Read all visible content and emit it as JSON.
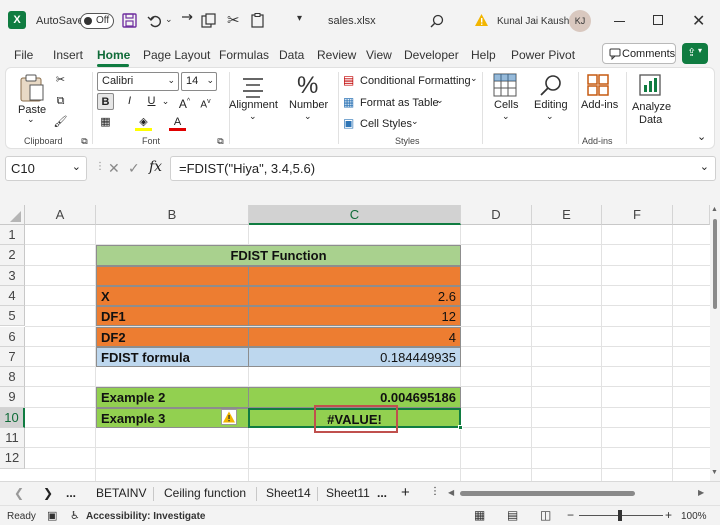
{
  "titlebar": {
    "autosave_label": "AutoSave",
    "autosave_state": "Off",
    "filename": "sales.xlsx",
    "user_name": "Kunal Jai Kaushik",
    "user_initials": "KJ"
  },
  "menu": {
    "items": [
      "File",
      "Insert",
      "Home",
      "Page Layout",
      "Formulas",
      "Data",
      "Review",
      "View",
      "Developer",
      "Help",
      "Power Pivot"
    ],
    "active": "Home",
    "comments_label": "Comments"
  },
  "ribbon": {
    "clipboard": {
      "paste": "Paste",
      "label": "Clipboard"
    },
    "font": {
      "name": "Calibri",
      "size": "14",
      "label": "Font",
      "bold": "B",
      "italic": "I",
      "underline": "U"
    },
    "alignment": {
      "label": "Alignment"
    },
    "number": {
      "label": "Number"
    },
    "styles": {
      "conditional": "Conditional Formatting",
      "table": "Format as Table",
      "cell_styles": "Cell Styles",
      "label": "Styles"
    },
    "cells": {
      "label": "Cells"
    },
    "editing": {
      "label": "Editing"
    },
    "addins": {
      "label": "Add-ins",
      "group_label": "Add-ins"
    },
    "analyze": {
      "label1": "Analyze",
      "label2": "Data"
    }
  },
  "formula_bar": {
    "name_box": "C10",
    "formula": "=FDIST(\"Hiya\", 3.4,5.6)"
  },
  "grid": {
    "columns": [
      "A",
      "B",
      "C",
      "D",
      "E",
      "F"
    ],
    "selected_column": "C",
    "rows": [
      "1",
      "2",
      "3",
      "4",
      "5",
      "6",
      "7",
      "8",
      "9",
      "10",
      "11",
      "12"
    ],
    "selected_row": "10",
    "title": "FDIST Function",
    "table": [
      {
        "row": "4",
        "label": "X",
        "value": "2.6"
      },
      {
        "row": "5",
        "label": "DF1",
        "value": "12"
      },
      {
        "row": "6",
        "label": "DF2",
        "value": "4"
      },
      {
        "row": "7",
        "label": "FDIST formula",
        "value": "0.184449935"
      },
      {
        "row": "9",
        "label": "Example 2",
        "value": "0.004695186"
      },
      {
        "row": "10",
        "label": "Example 3",
        "value": "#VALUE!"
      }
    ]
  },
  "sheets": {
    "tabs": [
      "BETAINV",
      "Ceiling function",
      "Sheet14",
      "Sheet11"
    ],
    "more": "..."
  },
  "status": {
    "ready": "Ready",
    "accessibility": "Accessibility: Investigate",
    "zoom": "100%"
  },
  "colors": {
    "green_header": "#a9d18e",
    "orange": "#ed7d31",
    "blue_light": "#bdd7ee",
    "green_bright": "#92d050",
    "accent": "#107c41",
    "error_outline": "#c0504d"
  }
}
